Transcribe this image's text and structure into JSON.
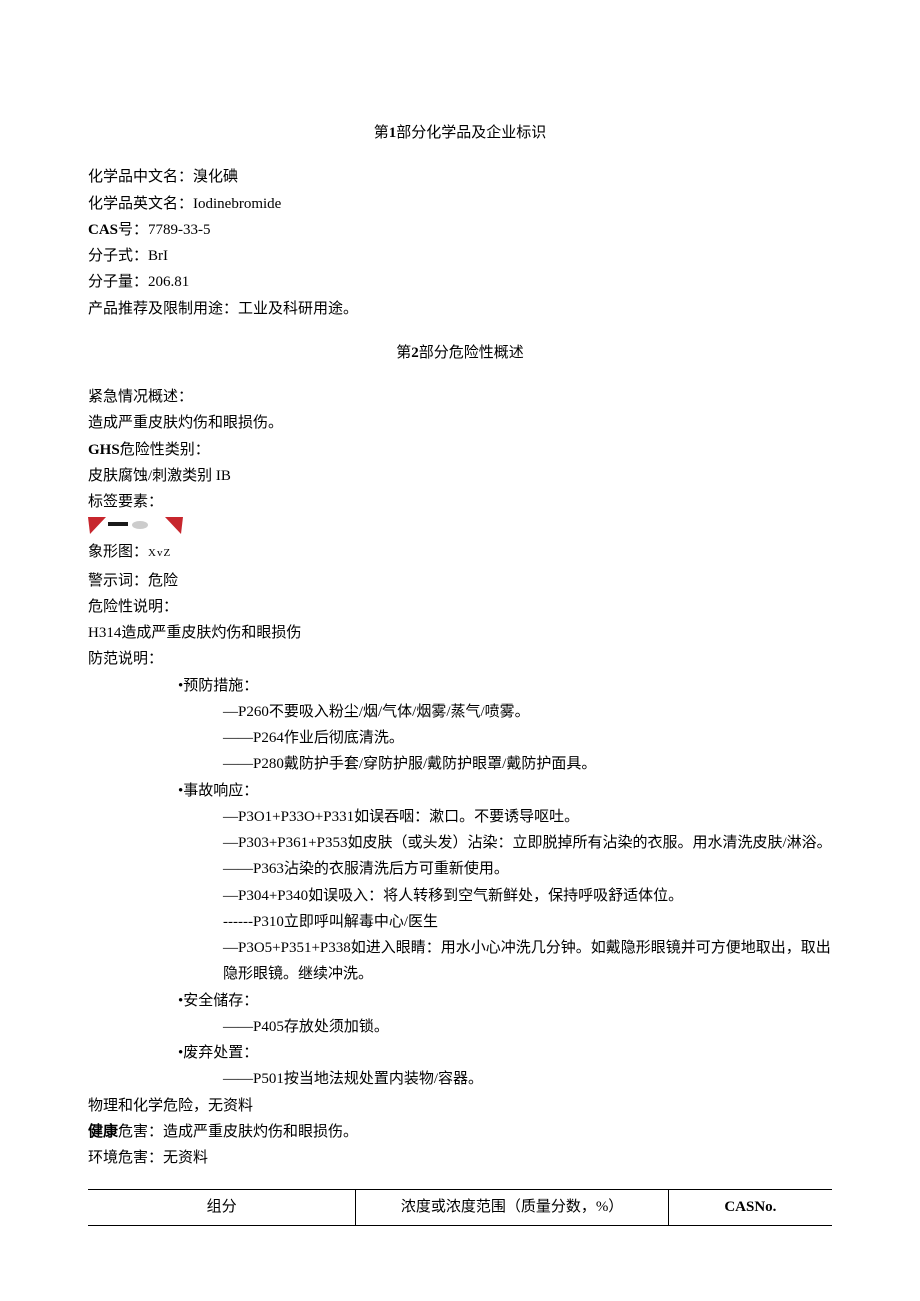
{
  "section1": {
    "title_prefix": "第",
    "title_num": "1",
    "title_suffix": "部分化学品及企业标识",
    "fields": {
      "name_cn_label": "化学品中文名：",
      "name_cn_value": "溴化碘",
      "name_en_label": "化学品英文名：",
      "name_en_value": "Iodinebromide",
      "cas_label": "CAS",
      "cas_label2": "号：",
      "cas_value": "7789-33-5",
      "formula_label": "分子式：",
      "formula_value": "BrI",
      "mw_label": "分子量：",
      "mw_value": "206.81",
      "use_label": "产品推荐及限制用途：",
      "use_value": "工业及科研用途。"
    }
  },
  "section2": {
    "title_prefix": "第",
    "title_num": "2",
    "title_suffix": "部分危险性概述",
    "emergency_label": "紧急情况概述：",
    "emergency_text": "造成严重皮肤灼伤和眼损伤。",
    "ghs_label": "GHS",
    "ghs_label2": "危险性类别：",
    "ghs_text": "皮肤腐蚀/刺激类别 IB",
    "label_elements": "标签要素：",
    "pictogram_label": "象形图：",
    "pictogram_marks": "XvZ",
    "signal_label": "警示词：",
    "signal_value": "危险",
    "hazard_stmt_label": "危险性说明：",
    "hazard_stmt": "H314造成严重皮肤灼伤和眼损伤",
    "precaution_label": "防范说明：",
    "groups": {
      "prevention": {
        "header": "•预防措施：",
        "items": [
          "—P260不要吸入粉尘/烟/气体/烟雾/蒸气/喷雾。",
          "——P264作业后彻底清洗。",
          "——P280戴防护手套/穿防护服/戴防护眼罩/戴防护面具。"
        ]
      },
      "response": {
        "header": "•事故响应：",
        "items": [
          "—P3O1+P33O+P331如误吞咽：漱口。不要诱导呕吐。",
          "—P303+P361+P353如皮肤（或头发）沾染：立即脱掉所有沾染的衣服。用水清洗皮肤/淋浴。",
          "——P363沾染的衣服清洗后方可重新使用。",
          "—P304+P340如误吸入：将人转移到空气新鲜处，保持呼吸舒适体位。",
          "------P310立即呼叫解毒中心/医生",
          "—P3O5+P351+P338如进入眼睛：用水小心冲洗几分钟。如戴隐形眼镜并可方便地取出，取出隐形眼镜。继续冲洗。"
        ]
      },
      "storage": {
        "header": "•安全储存：",
        "items": [
          "——P405存放处须加锁。"
        ]
      },
      "disposal": {
        "header": "•废弃处置：",
        "items": [
          "——P501按当地法规处置内装物/容器。"
        ]
      }
    },
    "phys_chem_label": "物理和化学危险，",
    "phys_chem_value": "无资料",
    "health_label": "健康",
    "health_label2": "危害：",
    "health_value": "造成严重皮肤灼伤和眼损伤。",
    "env_label": "环境危害：",
    "env_value": "无资料"
  },
  "table": {
    "headers": {
      "component": "组分",
      "concentration": "浓度或浓度范围（质量分数，%）",
      "cas": "CASNo."
    }
  }
}
